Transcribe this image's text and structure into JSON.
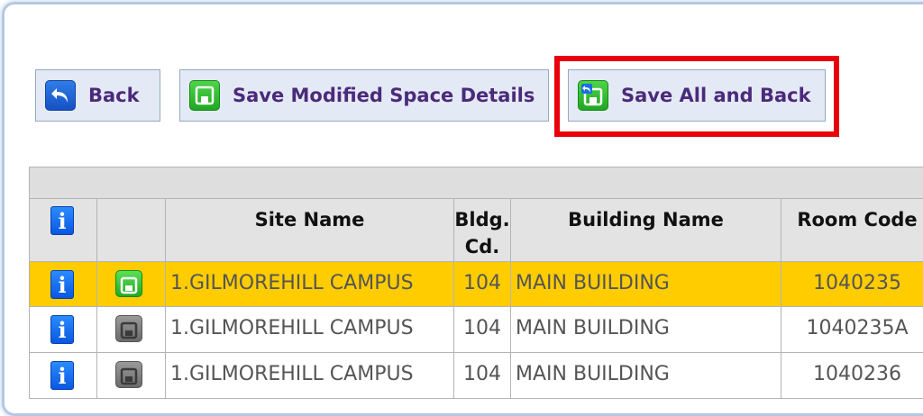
{
  "toolbar": {
    "back_label": "Back",
    "save_modified_label": "Save Modified Space Details",
    "save_all_back_label": "Save All and Back"
  },
  "table": {
    "columns": [
      "",
      "",
      "Site Name",
      "Bldg. Cd.",
      "Building Name",
      "Room Code"
    ],
    "rows": [
      {
        "site": "1.GILMOREHILL CAMPUS",
        "bldg_cd": "104",
        "building": "MAIN BUILDING",
        "room": "1040235",
        "selected": true
      },
      {
        "site": "1.GILMOREHILL CAMPUS",
        "bldg_cd": "104",
        "building": "MAIN BUILDING",
        "room": "1040235A",
        "selected": false
      },
      {
        "site": "1.GILMOREHILL CAMPUS",
        "bldg_cd": "104",
        "building": "MAIN BUILDING",
        "room": "1040236",
        "selected": false
      }
    ]
  },
  "icons": {
    "back": "back-arrow-icon",
    "save": "floppy-disk-icon",
    "save_back": "floppy-disk-back-icon",
    "info": "info-icon"
  },
  "colors": {
    "selected_row": "#ffcc00",
    "highlight_box": "#e8000b",
    "button_text": "#4b2a7a"
  }
}
